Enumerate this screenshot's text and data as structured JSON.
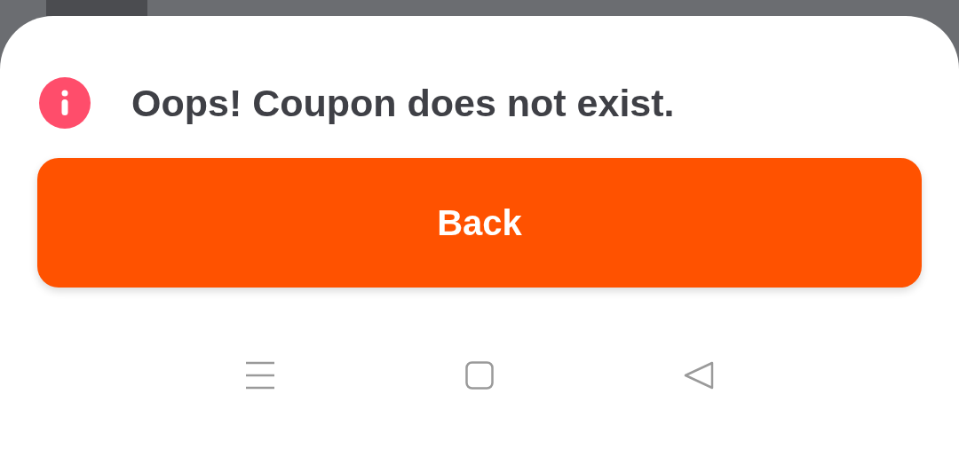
{
  "dialog": {
    "message": "Oops! Coupon does not exist.",
    "button": "Back"
  }
}
